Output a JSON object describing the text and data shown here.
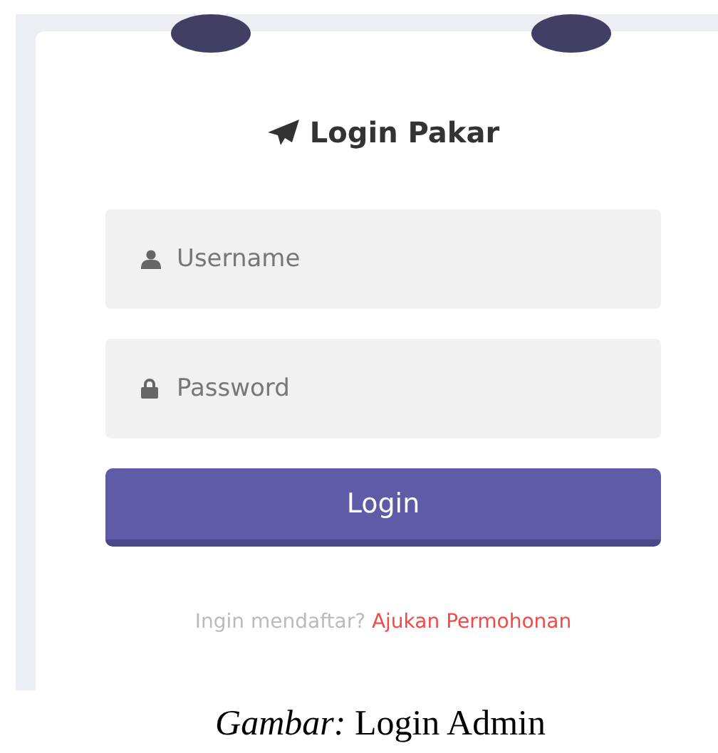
{
  "login_card": {
    "title": "Login Pakar",
    "fields": [
      {
        "kind": "username",
        "placeholder": "Username"
      },
      {
        "kind": "password",
        "placeholder": "Password"
      }
    ],
    "button": "Login",
    "register_prompt": "Ingin mendaftar?",
    "register_link": "Ajukan Permohonan"
  },
  "caption": "*Gambar:* Login Admin"
}
